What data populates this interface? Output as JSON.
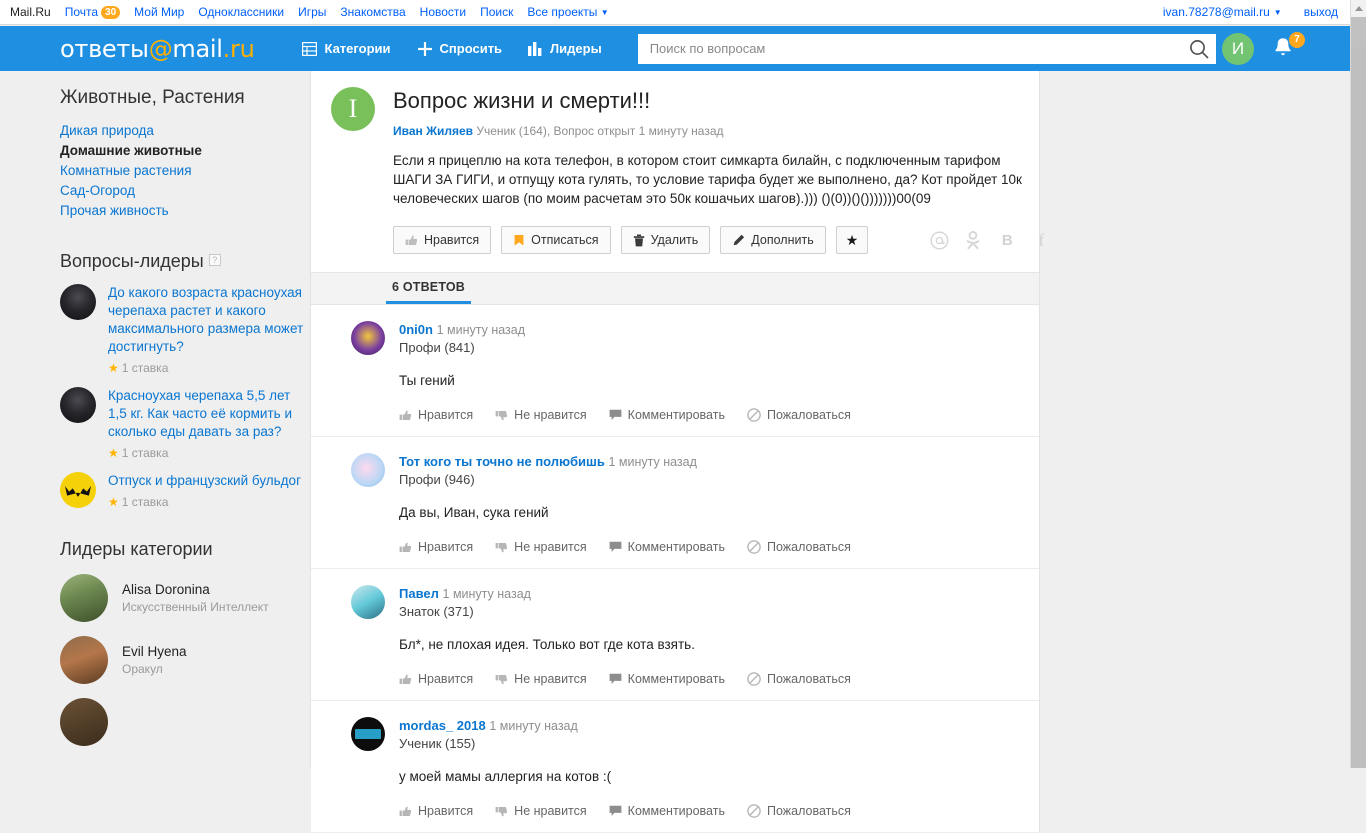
{
  "topbar": {
    "links": [
      {
        "label": "Mail.Ru",
        "badge": null
      },
      {
        "label": "Почта",
        "badge": "30"
      },
      {
        "label": "Мой Мир",
        "badge": null
      },
      {
        "label": "Одноклассники",
        "badge": null
      },
      {
        "label": "Игры",
        "badge": null
      },
      {
        "label": "Знакомства",
        "badge": null
      },
      {
        "label": "Новости",
        "badge": null
      },
      {
        "label": "Поиск",
        "badge": null
      },
      {
        "label": "Все проекты",
        "badge": null,
        "caret": true
      }
    ],
    "account": "ivan.78278@mail.ru",
    "logout": "выход"
  },
  "header": {
    "logo_prefix": "ответы",
    "logo_at": "@",
    "logo_mail": "mail",
    "logo_dot": ".",
    "logo_ru": "ru",
    "nav": [
      {
        "label": "Категории",
        "icon": "grid-icon"
      },
      {
        "label": "Спросить",
        "icon": "plus-icon"
      },
      {
        "label": "Лидеры",
        "icon": "bars-icon"
      }
    ],
    "search": {
      "placeholder": "Поиск по вопросам",
      "value": "",
      "icon": "search-icon"
    },
    "avatar_initial": "И",
    "notifications_count": "7",
    "accent_blue": "#1e8fe1",
    "accent_orange": "#ffa81e"
  },
  "sidebar": {
    "category_title": "Животные, Растения",
    "categories": [
      {
        "label": "Дикая природа",
        "active": false
      },
      {
        "label": "Домашние животные",
        "active": true
      },
      {
        "label": "Комнатные растения",
        "active": false
      },
      {
        "label": "Сад-Огород",
        "active": false
      },
      {
        "label": "Прочая живность",
        "active": false
      }
    ],
    "leader_questions_title": "Вопросы-лидеры",
    "leader_questions_help": "?",
    "leader_questions": [
      {
        "text": "До какого возраста красноухая черепаха растет и какого максимального размера может достигнуть?",
        "rating": "1 ставка",
        "avatar": "av-vader"
      },
      {
        "text": "Красноухая черепаха 5,5 лет 1,5 кг. Как часто её кормить и сколько еды давать за раз?",
        "rating": "1 ставка",
        "avatar": "av-vader"
      },
      {
        "text": "Отпуск и французский бульдог",
        "rating": "1 ставка",
        "avatar": "av-bat"
      }
    ],
    "category_leaders_title": "Лидеры категории",
    "category_leaders": [
      {
        "name": "Alisa Doronina",
        "rank": "Искусственный Интеллект",
        "avatar": "av-alisa"
      },
      {
        "name": "Evil Hyena",
        "rank": "Оракул",
        "avatar": "av-hyena"
      },
      {
        "name": "",
        "rank": "",
        "avatar": "av-dog3"
      }
    ]
  },
  "question": {
    "avatar_initial": "I",
    "title": "Вопрос жизни и смерти!!!",
    "author": "Иван Жиляев",
    "meta": "Ученик (164), Вопрос открыт 1 минуту назад",
    "body": "Если я прицеплю на кота телефон, в котором стоит симкарта билайн, с подключенным тарифом ШАГИ ЗА ГИГИ, и отпущу кота гулять, то условие тарифа будет же выполнено, да? Кот пройдет 10к человеческих шагов (по моим расчетам это 50к кошачьих шагов).))) ()(0))()()))))))00(09",
    "actions": [
      {
        "label": "Нравится",
        "icon": "thumb-up-icon"
      },
      {
        "label": "Отписаться",
        "icon": "flag-icon"
      },
      {
        "label": "Удалить",
        "icon": "trash-icon"
      },
      {
        "label": "Дополнить",
        "icon": "pencil-icon"
      }
    ],
    "favorite_icon": "star-icon",
    "social": [
      {
        "name": "mail-icon",
        "glyph": "@"
      },
      {
        "name": "odnoklassniki-icon",
        "glyph": "ok"
      },
      {
        "name": "vkontakte-icon",
        "glyph": "В"
      },
      {
        "name": "facebook-icon",
        "glyph": "f"
      }
    ]
  },
  "answers_tab": "6 ОТВЕТОВ",
  "answer_actions": [
    {
      "label": "Нравится",
      "icon": "thumb-up-icon"
    },
    {
      "label": "Не нравится",
      "icon": "thumb-down-icon"
    },
    {
      "label": "Комментировать",
      "icon": "comment-icon"
    },
    {
      "label": "Пожаловаться",
      "icon": "block-icon"
    }
  ],
  "answers": [
    {
      "name": "0ni0n",
      "time": "1 минуту назад",
      "rank": "Профи (841)",
      "text": "Ты гений",
      "avatar": "av-onion"
    },
    {
      "name": "Тот кого ты точно не полюбишь",
      "time": "1 минуту назад",
      "rank": "Профи (946)",
      "text": "Да вы, Иван, сука гений",
      "avatar": "av-pink"
    },
    {
      "name": "Павел",
      "time": "1 минуту назад",
      "rank": "Знаток (371)",
      "text": "Бл*, не плохая идея. Только вот где кота взять.",
      "avatar": "av-pavel"
    },
    {
      "name": "mordas_ 2018",
      "time": "1 минуту назад",
      "rank": "Ученик (155)",
      "text": "у моей мамы аллергия на котов :(",
      "avatar": "av-gamers"
    }
  ]
}
